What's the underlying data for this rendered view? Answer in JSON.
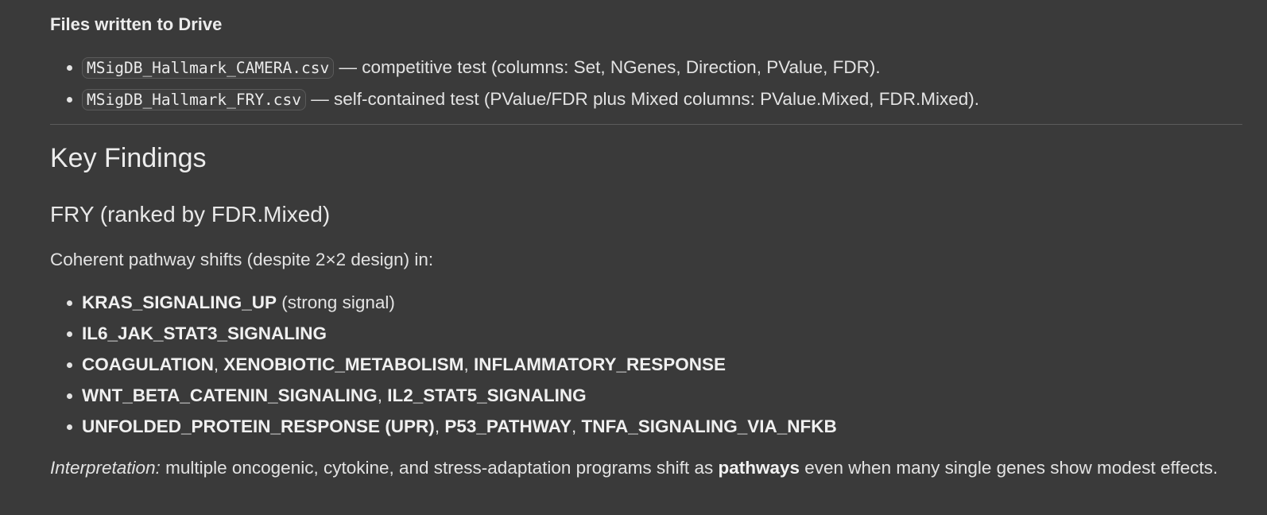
{
  "files_section": {
    "heading": "Files written to Drive",
    "items": [
      {
        "filename": "MSigDB_Hallmark_CAMERA.csv",
        "description": " — competitive test (columns: Set, NGenes, Direction, PValue, FDR)."
      },
      {
        "filename": "MSigDB_Hallmark_FRY.csv",
        "description": " — self-contained test (PValue/FDR plus Mixed columns: PValue.Mixed, FDR.Mixed)."
      }
    ]
  },
  "key_findings": {
    "heading": "Key Findings",
    "subheading": "FRY (ranked by FDR.Mixed)",
    "intro": "Coherent pathway shifts (despite 2×2 design) in:",
    "items": [
      {
        "bold": "KRAS_SIGNALING_UP",
        "rest": " (strong signal)"
      },
      {
        "bold": "IL6_JAK_STAT3_SIGNALING",
        "rest": ""
      },
      {
        "bold": "COAGULATION",
        "sep1": ", ",
        "bold2": "XENOBIOTIC_METABOLISM",
        "sep2": ", ",
        "bold3": "INFLAMMATORY_RESPONSE"
      },
      {
        "bold": "WNT_BETA_CATENIN_SIGNALING",
        "sep1": ", ",
        "bold2": "IL2_STAT5_SIGNALING"
      },
      {
        "bold": "UNFOLDED_PROTEIN_RESPONSE (UPR)",
        "sep1": ", ",
        "bold2": "P53_PATHWAY",
        "sep2": ", ",
        "bold3": "TNFA_SIGNALING_VIA_NFKB"
      }
    ],
    "interpretation": {
      "label": "Interpretation:",
      "text_before": " multiple oncogenic, cytokine, and stress-adaptation programs shift as ",
      "emphasis": "pathways",
      "text_after": " even when many single genes show modest effects."
    }
  }
}
